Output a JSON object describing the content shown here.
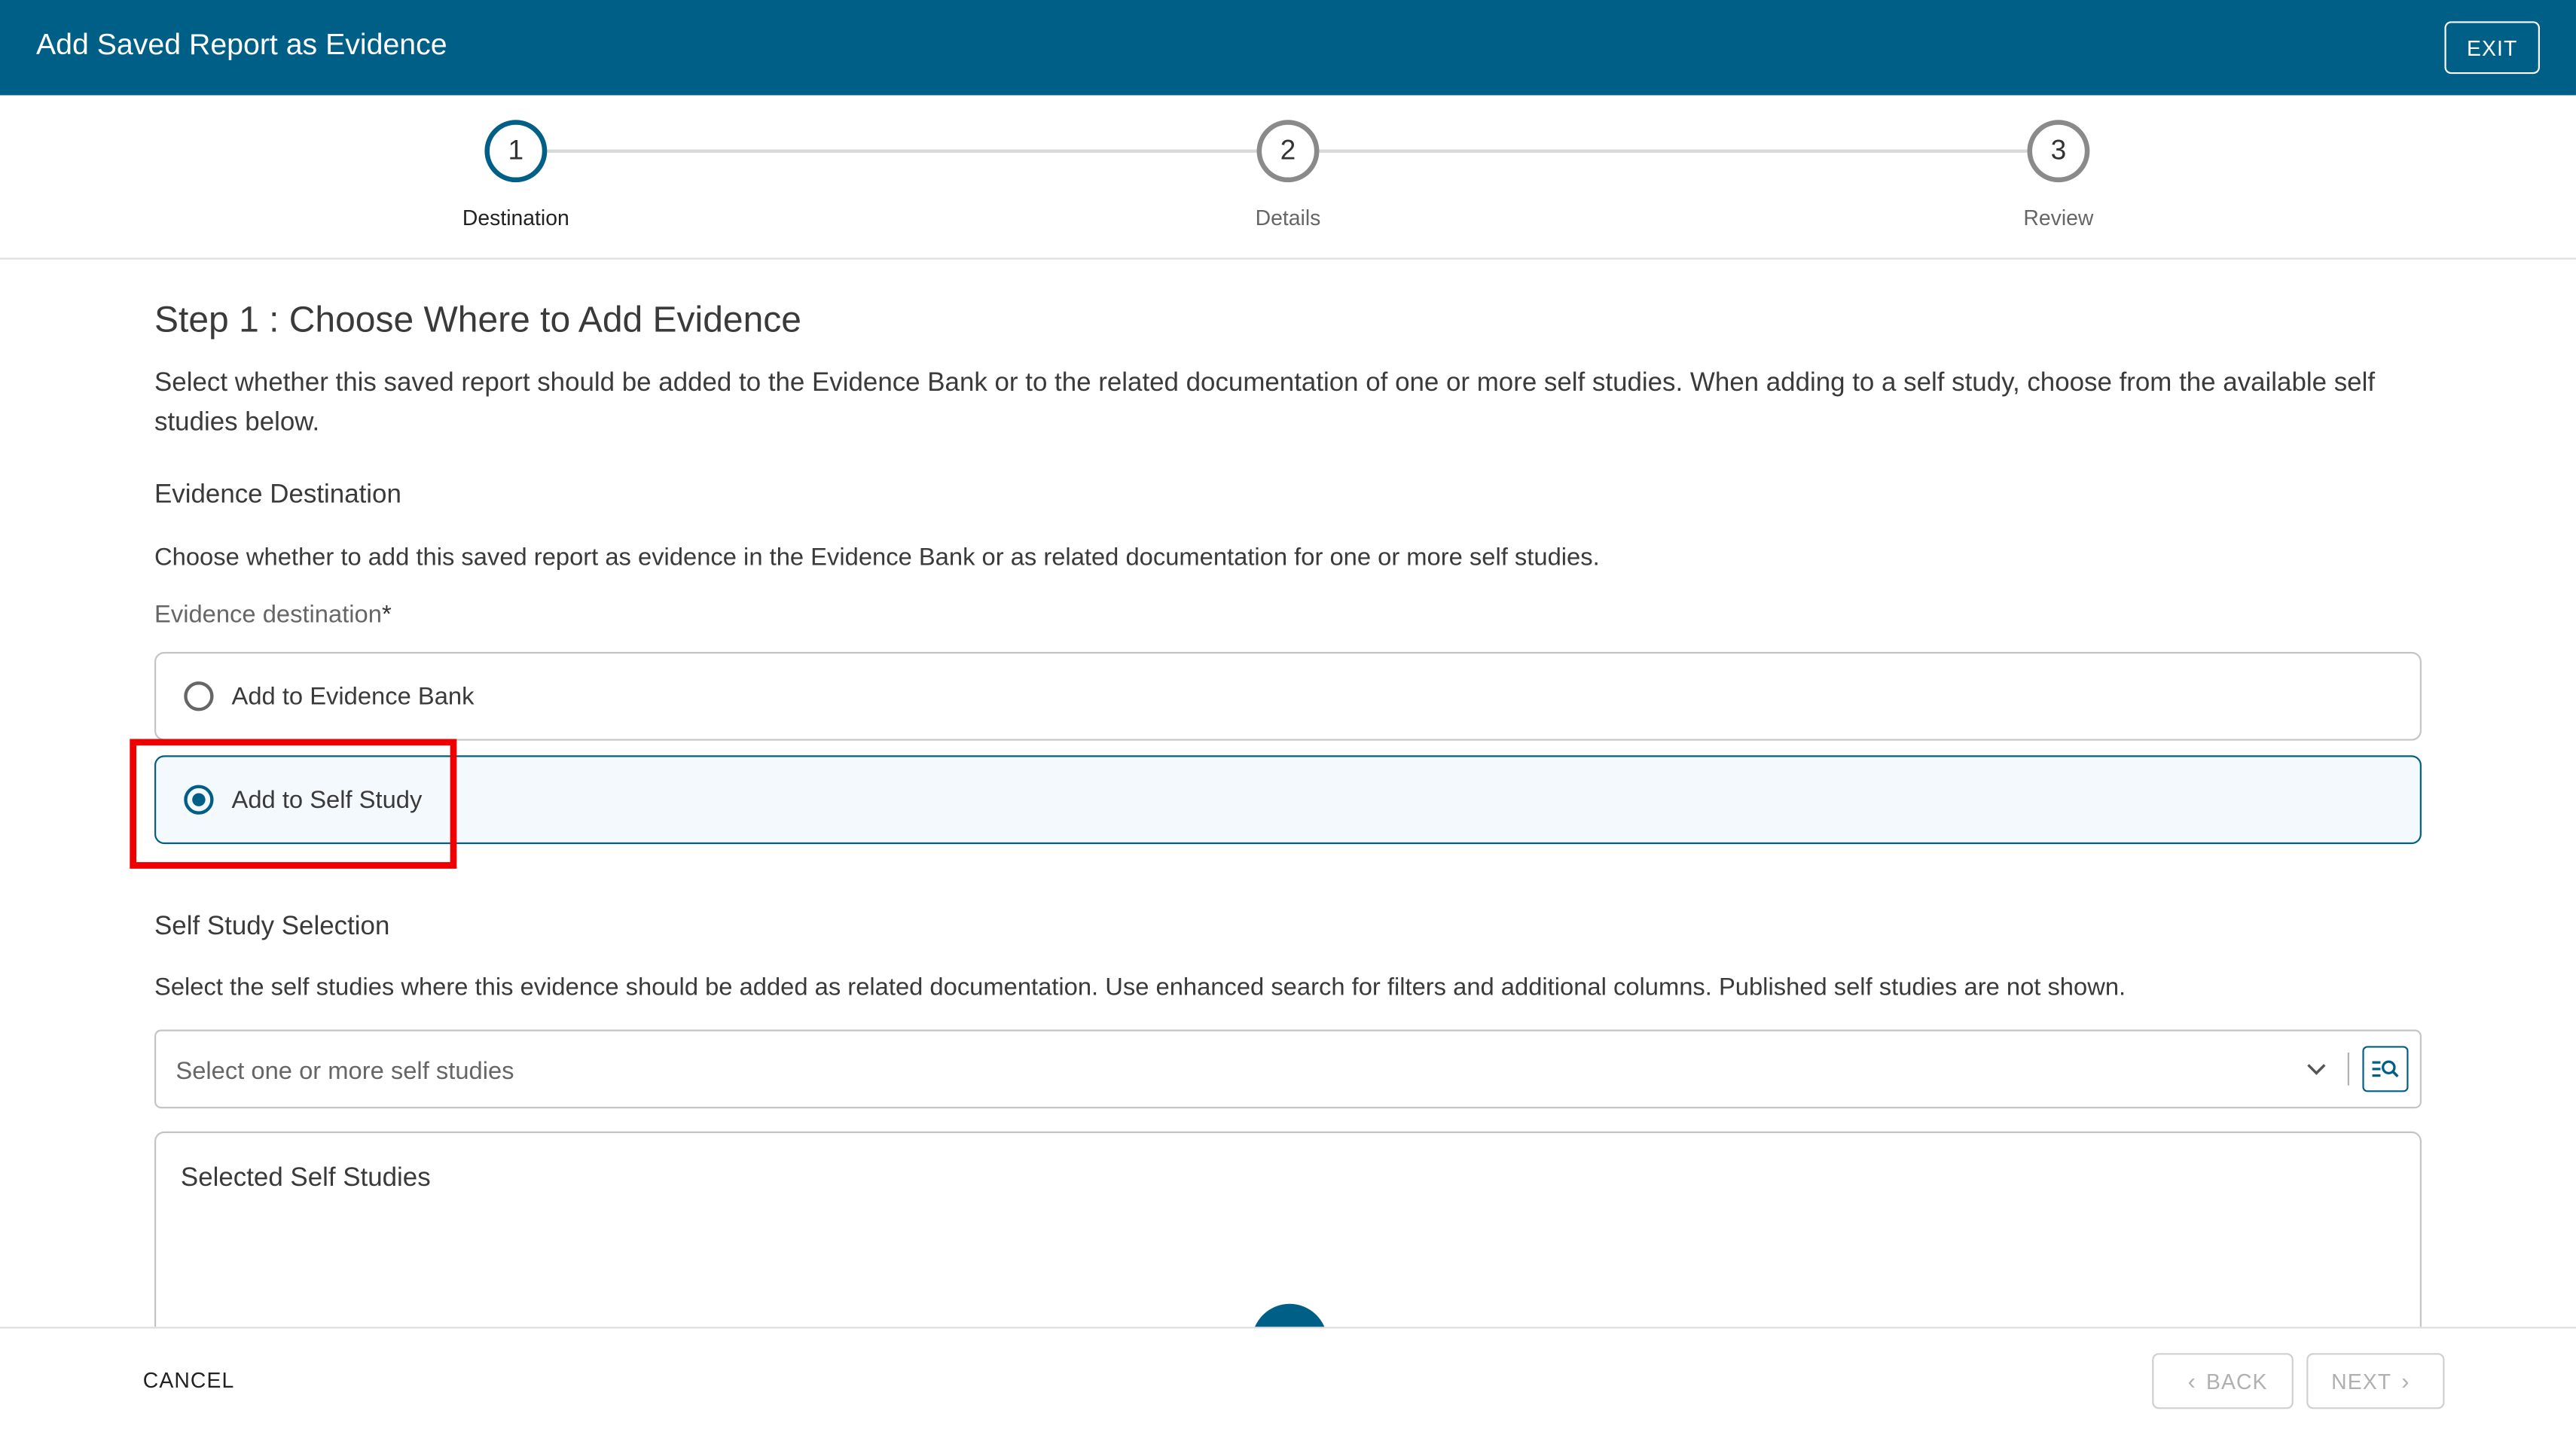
{
  "header": {
    "title": "Add Saved Report as Evidence",
    "exit_label": "EXIT",
    "background": "#005f87"
  },
  "stepper": {
    "steps": [
      {
        "number": "1",
        "label": "Destination",
        "active": true
      },
      {
        "number": "2",
        "label": "Details",
        "active": false
      },
      {
        "number": "3",
        "label": "Review",
        "active": false
      }
    ]
  },
  "main": {
    "step_title": "Step 1 : Choose Where to Add Evidence",
    "intro": "Select whether this saved report should be added to the Evidence Bank or to the related documentation of one or more self studies. When adding to a self study, choose from the available self studies below.",
    "destination": {
      "title": "Evidence Destination",
      "description": "Choose whether to add this saved report as evidence in the Evidence Bank or as related documentation for one or more self studies.",
      "field_label": "Evidence destination",
      "required_mark": "*",
      "options": [
        {
          "label": "Add to Evidence Bank",
          "selected": false
        },
        {
          "label": "Add to Self Study",
          "selected": true
        }
      ]
    },
    "self_study": {
      "title": "Self Study Selection",
      "description": "Select the self studies where this evidence should be added as related documentation. Use enhanced search for filters and additional columns. Published self studies are not shown.",
      "select_placeholder": "Select one or more self studies",
      "selected_panel_title": "Selected Self Studies"
    }
  },
  "footer": {
    "cancel_label": "CANCEL",
    "back_label": "BACK",
    "next_label": "NEXT"
  },
  "colors": {
    "accent": "#005f87",
    "highlight": "#ee0000"
  }
}
